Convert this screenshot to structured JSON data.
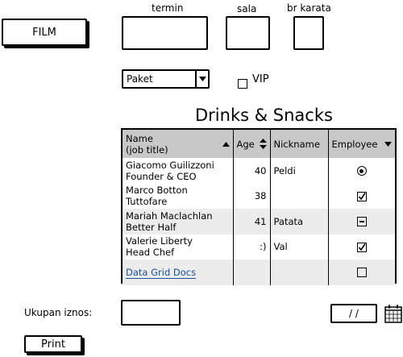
{
  "film_button": "FILM",
  "termin_label": "termin",
  "sala_label": "sala",
  "br_karata_label": "br karata",
  "paket_select": {
    "value": "Paket"
  },
  "vip_label": "VIP",
  "grid_title": "Drinks & Snacks",
  "grid": {
    "columns": [
      {
        "label": "Name\n(job title)"
      },
      {
        "label": "Age"
      },
      {
        "label": "Nickname"
      },
      {
        "label": "Employee"
      }
    ],
    "rows": [
      {
        "name": "Giacomo Guilizzoni",
        "title": "Founder & CEO",
        "age": "40",
        "nickname": "Peldi",
        "employee": "radio"
      },
      {
        "name": "Marco Botton",
        "title": "Tuttofare",
        "age": "38",
        "nickname": "",
        "employee": "checked"
      },
      {
        "name": "Mariah Maclachlan",
        "title": "Better Half",
        "age": "41",
        "nickname": "Patata",
        "employee": "indeterminate"
      },
      {
        "name": "Valerie Liberty",
        "title": "Head Chef",
        "age": ":)",
        "nickname": "Val",
        "employee": "checked"
      },
      {
        "link": "Data Grid Docs",
        "employee": "unchecked"
      }
    ]
  },
  "ukupan_label": "Ukupan iznos:",
  "date_value": "/  /",
  "print_button": "Print"
}
